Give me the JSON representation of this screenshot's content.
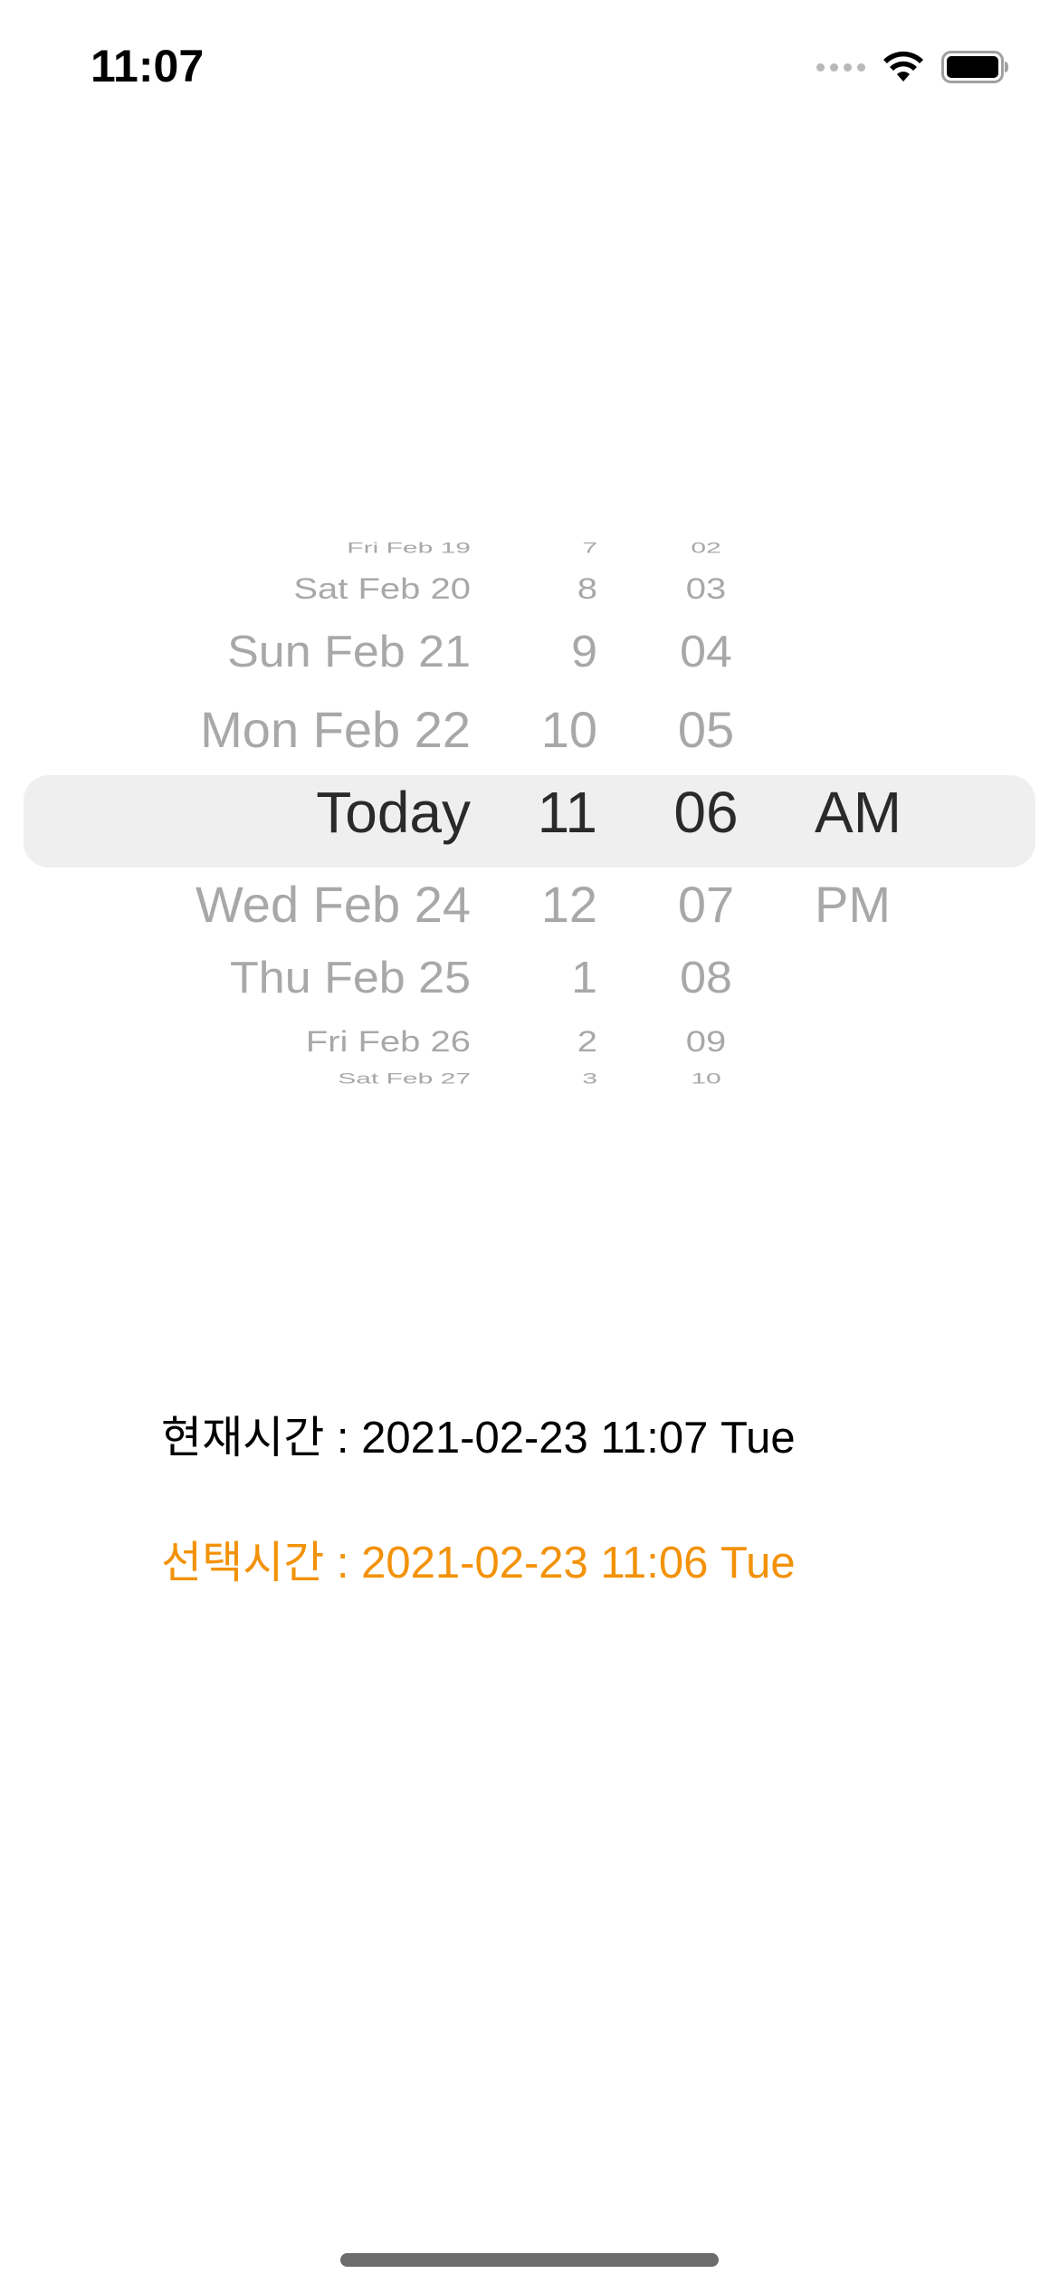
{
  "status_bar": {
    "time": "11:07"
  },
  "picker": {
    "rows": [
      {
        "date": "Fri Feb 19",
        "hour": "7",
        "minute": "02",
        "ampm": ""
      },
      {
        "date": "Sat Feb 20",
        "hour": "8",
        "minute": "03",
        "ampm": ""
      },
      {
        "date": "Sun Feb 21",
        "hour": "9",
        "minute": "04",
        "ampm": ""
      },
      {
        "date": "Mon Feb 22",
        "hour": "10",
        "minute": "05",
        "ampm": ""
      },
      {
        "date": "Today",
        "hour": "11",
        "minute": "06",
        "ampm": "AM"
      },
      {
        "date": "Wed Feb 24",
        "hour": "12",
        "minute": "07",
        "ampm": "PM"
      },
      {
        "date": "Thu Feb 25",
        "hour": "1",
        "minute": "08",
        "ampm": ""
      },
      {
        "date": "Fri Feb 26",
        "hour": "2",
        "minute": "09",
        "ampm": ""
      },
      {
        "date": "Sat Feb 27",
        "hour": "3",
        "minute": "10",
        "ampm": ""
      }
    ]
  },
  "info": {
    "current_label": "현재시간 : 2021-02-23 11:07 Tue",
    "selected_label": "선택시간 : 2021-02-23 11:06 Tue"
  },
  "colors": {
    "selected_text": "#f39208",
    "picker_band": "#efefef"
  }
}
